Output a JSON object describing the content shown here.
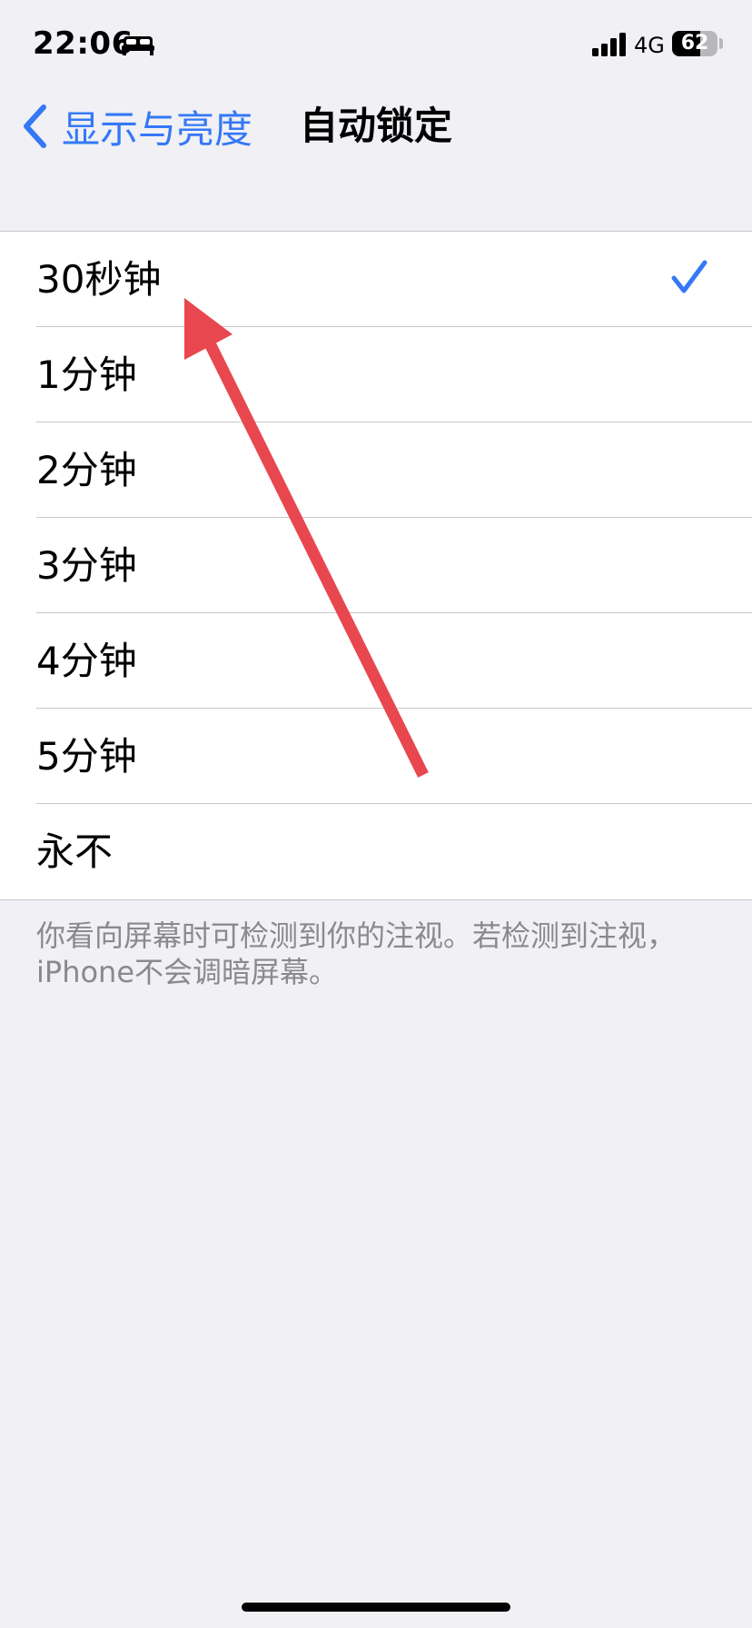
{
  "status_bar": {
    "time": "22:06",
    "network": "4G",
    "battery_level": 62,
    "battery_text": "62"
  },
  "nav": {
    "back_label": "显示与亮度",
    "title": "自动锁定"
  },
  "options": [
    {
      "label": "30秒钟",
      "selected": true
    },
    {
      "label": "1分钟",
      "selected": false
    },
    {
      "label": "2分钟",
      "selected": false
    },
    {
      "label": "3分钟",
      "selected": false
    },
    {
      "label": "4分钟",
      "selected": false
    },
    {
      "label": "5分钟",
      "selected": false
    },
    {
      "label": "永不",
      "selected": false
    }
  ],
  "footer_note": "你看向屏幕时可检测到你的注视。若检测到注视，iPhone不会调暗屏幕。",
  "colors": {
    "accent": "#3478F6",
    "background": "#F0F0F5",
    "annotation_arrow": "#E8474F"
  },
  "icons": {
    "back": "chevron-left-icon",
    "check": "checkmark-icon",
    "bed": "bed-icon",
    "signal": "signal-icon"
  }
}
